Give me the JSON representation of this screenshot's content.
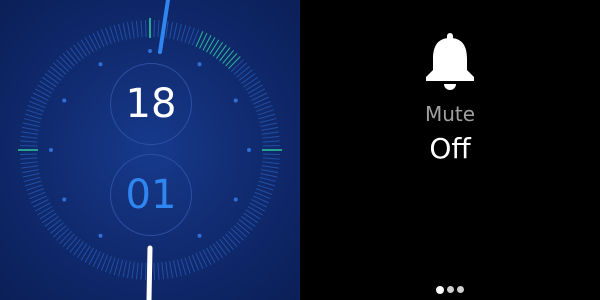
{
  "watch_face": {
    "hour": "18",
    "minute": "01",
    "colors": {
      "background": "#0b1f58",
      "tick": "#2f6fd6",
      "tick_highlight": "#2fc7a0",
      "minute_text": "#2f86f0",
      "hand_minute": "#2f86f0",
      "hand_hour": "#ffffff"
    }
  },
  "quick_setting": {
    "icon": "bell-icon",
    "label": "Mute",
    "state": "Off"
  },
  "pager": {
    "page_count": 3,
    "active_index": 0
  }
}
